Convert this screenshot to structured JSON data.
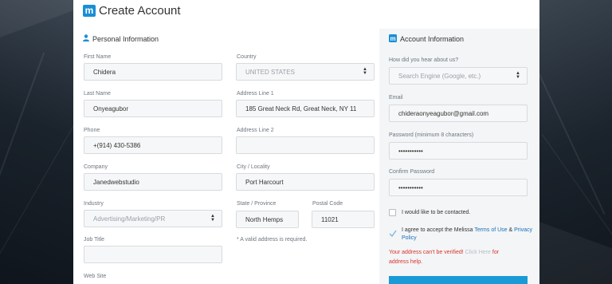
{
  "header": {
    "logo_letter": "m",
    "title": "Create Account"
  },
  "personal": {
    "title": "Personal Information",
    "first_name": {
      "label": "First Name",
      "value": "Chidera"
    },
    "last_name": {
      "label": "Last Name",
      "value": "Onyeagubor"
    },
    "phone": {
      "label": "Phone",
      "value": "+(914) 430-5386"
    },
    "company": {
      "label": "Company",
      "value": "Janedwebstudio"
    },
    "industry": {
      "label": "Industry",
      "value": "Advertising/Marketing/PR"
    },
    "job_title": {
      "label": "Job Title",
      "value": ""
    },
    "web_site": {
      "label": "Web Site"
    },
    "country": {
      "label": "Country",
      "value": "UNITED STATES"
    },
    "address1": {
      "label": "Address Line 1",
      "value": "185 Great Neck Rd, Great Neck, NY 11"
    },
    "address2": {
      "label": "Address Line 2",
      "value": ""
    },
    "city": {
      "label": "City / Locality",
      "value": "Port Harcourt"
    },
    "state": {
      "label": "State / Province",
      "value": "North Hemps"
    },
    "postal": {
      "label": "Postal Code",
      "value": "11021"
    },
    "address_note": "* A valid address is required."
  },
  "account": {
    "title": "Account Information",
    "heard": {
      "label": "How did you hear about us?",
      "placeholder": "Search Engine (Google, etc.)"
    },
    "email": {
      "label": "Email",
      "value": "chideraonyeagubor@gmail.com"
    },
    "password": {
      "label": "Password (minimum 8 characters)",
      "value": "•••••••••••"
    },
    "confirm": {
      "label": "Confirm Password",
      "value": "•••••••••••"
    },
    "contact_label": "I would like to be contacted.",
    "terms_prefix": "I agree to accept the Melissa ",
    "terms_link": "Terms of Use",
    "terms_and": " & ",
    "privacy_link": "Privacy Policy",
    "error_text": "Your address can't be verified! ",
    "error_link": "Click Here",
    "error_suffix": " for",
    "error_line2": "address help."
  },
  "colors": {
    "accent": "#1a8ed6",
    "error": "#d9342b",
    "link": "#1a6fb8"
  }
}
